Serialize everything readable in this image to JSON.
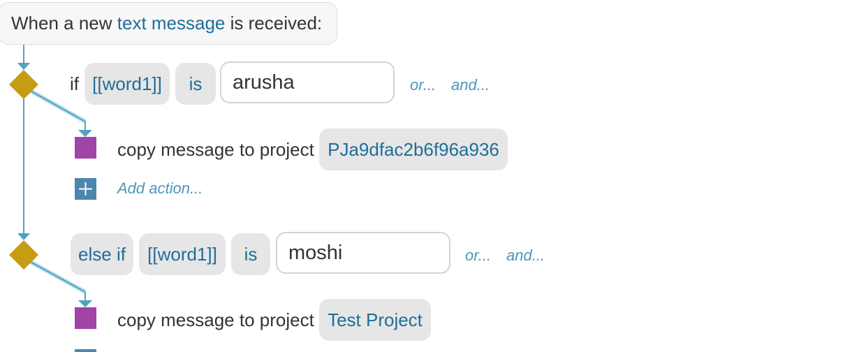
{
  "trigger": {
    "prefix": "When a new",
    "event": "text message",
    "suffix": "is received:"
  },
  "branches": [
    {
      "keyword": "if",
      "variable": "[[word1]]",
      "operator": "is",
      "value": "arusha",
      "or_label": "or...",
      "and_label": "and...",
      "action_text": "copy message to project",
      "project": "PJa9dfac2b6f96a936",
      "add_action": "Add action..."
    },
    {
      "keyword": "else if",
      "variable": "[[word1]]",
      "operator": "is",
      "value": "moshi",
      "or_label": "or...",
      "and_label": "and...",
      "action_text": "copy message to project",
      "project": "Test Project"
    }
  ],
  "colors": {
    "connector": "#4fa3c2",
    "condition_diamond": "#c69c12",
    "action_square": "#a044a6",
    "add_button": "#4c86ad",
    "link": "#1f6e99"
  }
}
